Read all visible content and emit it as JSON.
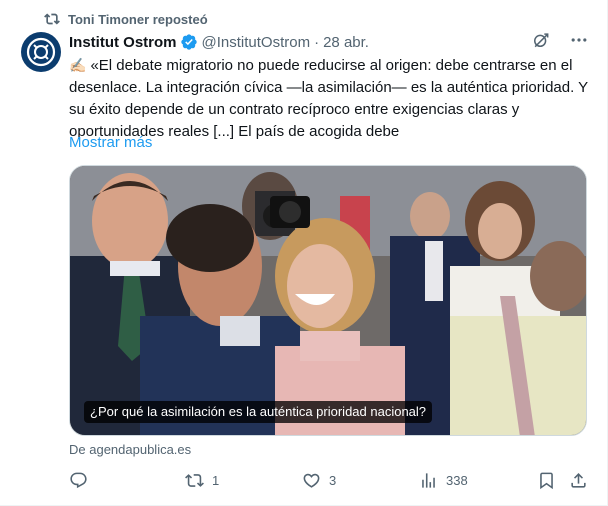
{
  "repost": {
    "text": "Toni Timoner reposteó",
    "icon": "repost-icon"
  },
  "author": {
    "name": "Institut Ostrom",
    "handle": "@InstitutOstrom",
    "separator": "·",
    "date": "28 abr.",
    "verified": true
  },
  "tweet": {
    "emoji": "✍🏻",
    "text": "«El debate migratorio no puede reducirse al origen: debe centrarse en el desenlace. La integración cívica —la asimilación— es la auténtica prioridad. Y su éxito depende de un contrato recíproco entre exigencias claras y oportunidades reales [...] El país de acogida debe",
    "show_more": "Mostrar más"
  },
  "media": {
    "caption": "¿Por qué la asimilación es la auténtica prioridad nacional?"
  },
  "source": "De agendapublica.es",
  "actions": {
    "replies": "",
    "reposts": "1",
    "likes": "3",
    "views": "338"
  },
  "colors": {
    "accent": "#1d9bf0",
    "muted": "#536471",
    "text": "#0f1419",
    "verified": "#1d9bf0"
  }
}
